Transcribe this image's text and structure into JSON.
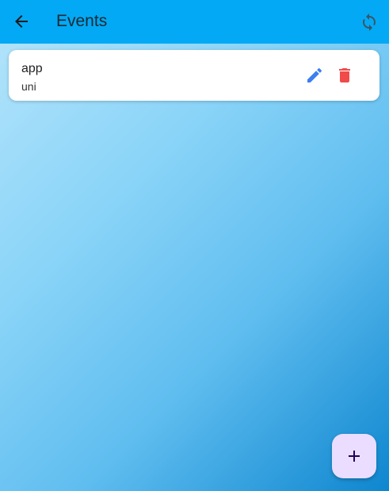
{
  "app_bar": {
    "title": "Events",
    "background_color": "#03a9f4",
    "back_icon": "arrow-back-icon",
    "refresh_icon": "sync-icon"
  },
  "events": [
    {
      "name": "app",
      "subtitle": "uni",
      "edit_icon": "pencil-icon",
      "delete_icon": "trash-icon"
    }
  ],
  "colors": {
    "edit_icon": "#3d7ff0",
    "delete_icon": "#f04a4a",
    "fab_background": "#eaddff",
    "fab_icon": "#21005d"
  },
  "fab": {
    "icon": "plus-icon"
  }
}
